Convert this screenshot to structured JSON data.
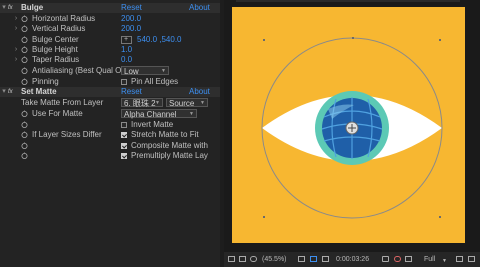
{
  "effects_panel": {
    "bulge": {
      "fx_label": "fx",
      "name": "Bulge",
      "reset": "Reset",
      "about": "About",
      "properties": {
        "horizontal_radius": {
          "label": "Horizontal Radius",
          "value": "200.0"
        },
        "vertical_radius": {
          "label": "Vertical Radius",
          "value": "200.0"
        },
        "bulge_center": {
          "label": "Bulge Center",
          "value": "540.0 ,540.0"
        },
        "bulge_height": {
          "label": "Bulge Height",
          "value": "1.0"
        },
        "taper_radius": {
          "label": "Taper Radius",
          "value": "0.0"
        },
        "antialiasing": {
          "label": "Antialiasing (Best Qual O",
          "value": "Low"
        },
        "pinning": {
          "label": "Pinning",
          "checkbox_label": "Pin All Edges",
          "checked": false
        }
      }
    },
    "set_matte": {
      "fx_label": "fx",
      "name": "Set Matte",
      "reset": "Reset",
      "about": "About",
      "properties": {
        "take_matte_from_layer": {
          "label": "Take Matte From Layer",
          "layer": "6. 眼珠 2",
          "source": "Source"
        },
        "use_for_matte": {
          "label": "Use For Matte",
          "value": "Alpha Channel"
        },
        "invert_matte": {
          "checkbox_label": "Invert Matte",
          "checked": false
        },
        "if_layer_sizes_differ": {
          "label": "If Layer Sizes Differ",
          "checkbox_label": "Stretch Matte to Fit",
          "checked": true
        },
        "composite_matte": {
          "checkbox_label": "Composite Matte with",
          "checked": true
        },
        "premultiply": {
          "checkbox_label": "Premultiply Matte Lay",
          "checked": true
        }
      }
    }
  },
  "viewer": {
    "background_color": "#f7b731",
    "eye_outline_color": "#ffffff",
    "iris_color": "#5cc9b5",
    "pupil_color": "#1f5fa8",
    "overlay_circle_color": "#8a8a8a"
  },
  "bottom_bar": {
    "zoom": "(45.5%)",
    "timecode": "0:00:03:26",
    "resolution": "Full"
  }
}
